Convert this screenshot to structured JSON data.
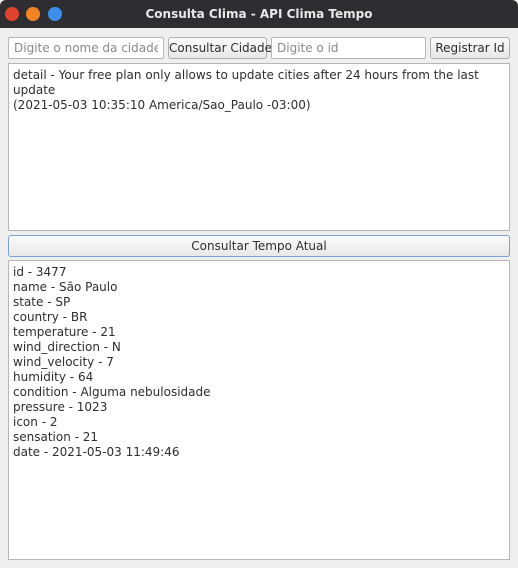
{
  "window": {
    "title": "Consulta Clima - API Clima Tempo"
  },
  "toolbar": {
    "city_placeholder": "Digite o nome da cidade",
    "city_value": "",
    "search_city_label": "Consultar Cidade",
    "id_placeholder": "Digite o id",
    "id_value": "",
    "register_id_label": "Registrar Id"
  },
  "message": {
    "lines": [
      "detail - Your free plan only allows to update cities after 24 hours from the last update",
      "(2021-05-03 10:35:10 America/Sao_Paulo -03:00)"
    ]
  },
  "weather_button": {
    "label": "Consultar Tempo Atual"
  },
  "result": {
    "lines": [
      "id - 3477",
      "name - São Paulo",
      "state - SP",
      "country - BR",
      "temperature - 21",
      "wind_direction - N",
      "wind_velocity - 7",
      "humidity - 64",
      "condition - Alguma nebulosidade",
      "pressure - 1023",
      "icon - 2",
      "sensation - 21",
      "date - 2021-05-03 11:49:46"
    ]
  }
}
